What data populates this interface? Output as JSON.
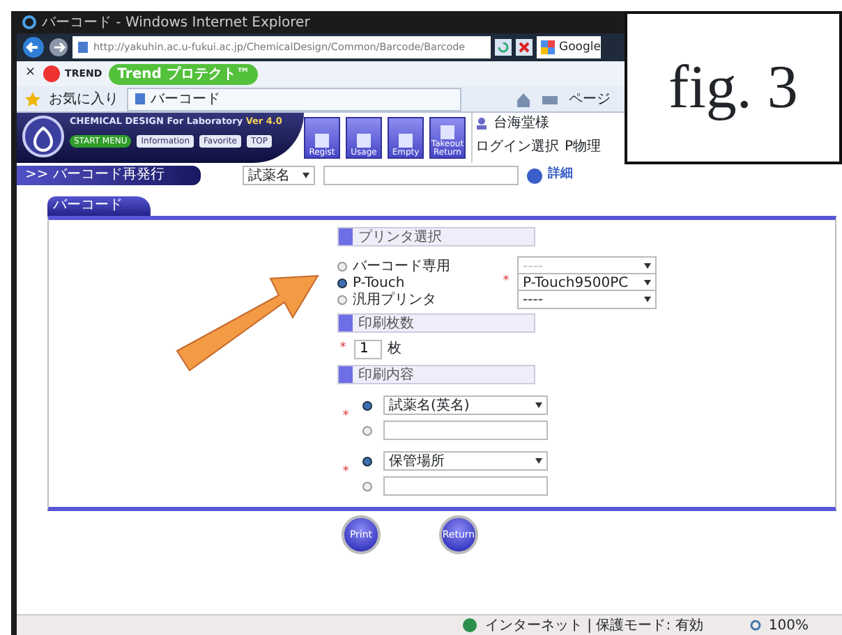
{
  "window": {
    "title": "バーコード - Windows Internet Explorer"
  },
  "address_bar": {
    "url": "http://yakuhin.ac.u-fukui.ac.jp/ChemicalDesign/Common/Barcode/Barcode",
    "search_engine": "Google"
  },
  "toolbar": {
    "close": "×",
    "items": [
      {
        "label": "TREND",
        "kind": "brand"
      },
      {
        "label": "Trend プロテクト™",
        "kind": "pill"
      }
    ]
  },
  "favorites_bar": {
    "favorites": "お気に入り",
    "tab": "バーコード",
    "page_menu": "ページ"
  },
  "app_header": {
    "product": "CHEMICAL DESIGN For Laboratory",
    "version": "Ver 4.0",
    "nav": [
      {
        "label": "START MENU",
        "selected": true
      },
      {
        "label": "Information",
        "selected": false
      },
      {
        "label": "Favorite",
        "selected": false
      },
      {
        "label": "TOP",
        "selected": false
      }
    ],
    "tools": [
      {
        "label": "Regist"
      },
      {
        "label": "Usage"
      },
      {
        "label": "Empty"
      },
      {
        "label": "Takeout Return"
      }
    ],
    "user": "台海堂様",
    "login_label": "ログイン選択",
    "group": "P物理"
  },
  "subbar": {
    "breadcrumb": ">> バーコード再発行",
    "search_field": "試薬名",
    "detail": "詳細"
  },
  "panel": {
    "tab": "バーコード",
    "printer": {
      "heading": "プリンタ選択",
      "options": [
        {
          "label": "バーコード専用",
          "selected": false,
          "printer": "----",
          "disabled": true
        },
        {
          "label": "P-Touch",
          "selected": true,
          "printer": "P-Touch9500PC",
          "required_mark": "*",
          "disabled": false
        },
        {
          "label": "汎用プリンタ",
          "selected": false,
          "printer": "----",
          "disabled": false
        }
      ]
    },
    "copies": {
      "heading": "印刷枚数",
      "required_mark": "*",
      "value": "1",
      "unit": "枚"
    },
    "contents": {
      "heading": "印刷内容",
      "groups": [
        {
          "required_mark": "*",
          "options": [
            {
              "kind": "select",
              "value": "試薬名(英名)",
              "selected": true
            },
            {
              "kind": "text",
              "selected": false
            }
          ]
        },
        {
          "required_mark": "*",
          "options": [
            {
              "kind": "select",
              "value": "保管場所",
              "selected": true
            },
            {
              "kind": "text",
              "selected": false
            }
          ]
        }
      ]
    }
  },
  "buttons": [
    "Print",
    "Return"
  ],
  "status_bar": {
    "zone": "インターネット | 保護モード: 有効",
    "zoom": "100%"
  },
  "figure_label": "fig. 3"
}
